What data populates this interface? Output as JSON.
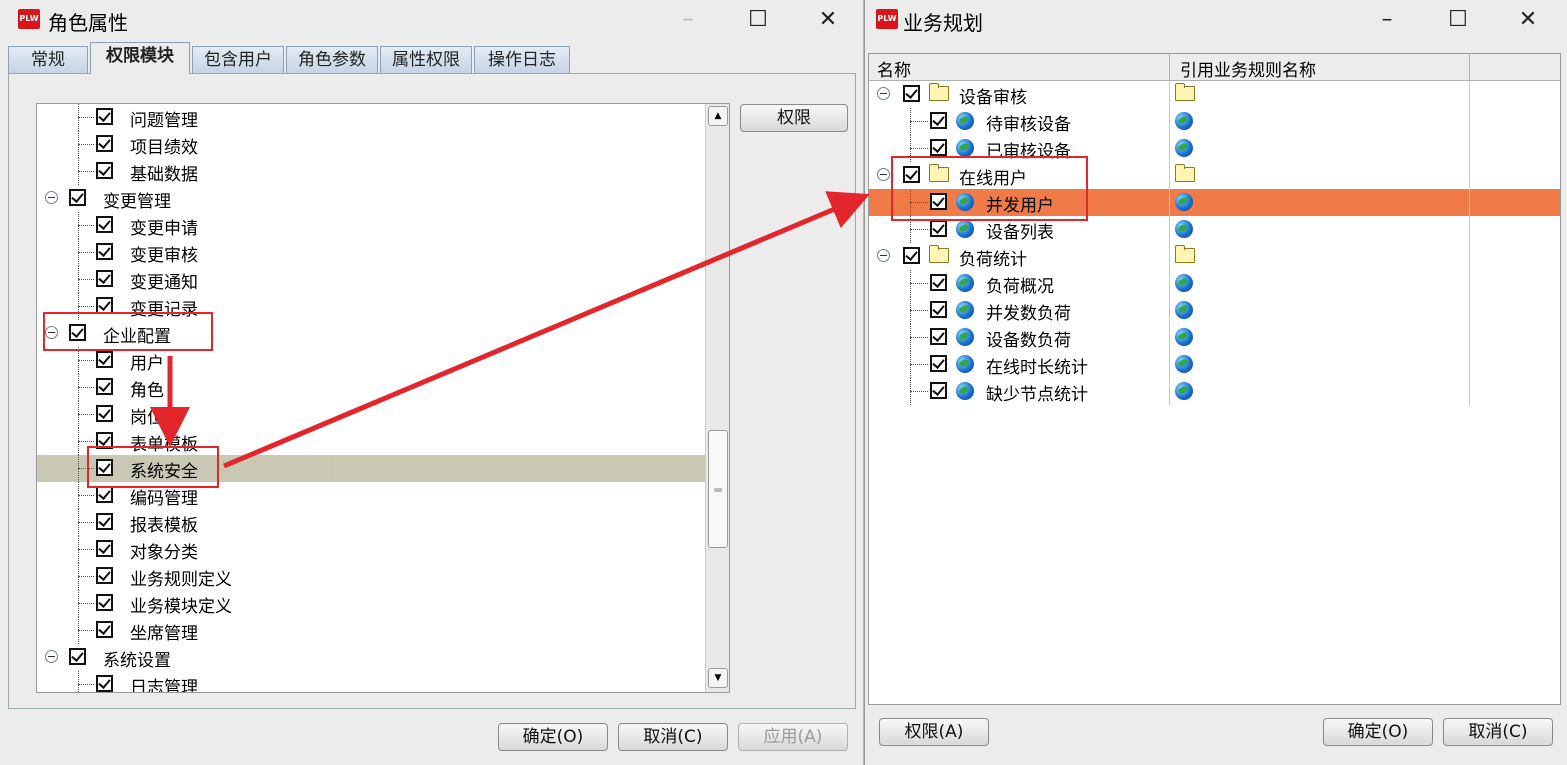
{
  "left_window": {
    "title": "角色属性",
    "logo": "PLW",
    "tabs": [
      "常规",
      "权限模块",
      "包含用户",
      "角色参数",
      "属性权限",
      "操作日志"
    ],
    "tree": [
      {
        "label": "问题管理",
        "level": 1
      },
      {
        "label": "项目绩效",
        "level": 1
      },
      {
        "label": "基础数据",
        "level": 1
      },
      {
        "label": "变更管理",
        "level": 0
      },
      {
        "label": "变更申请",
        "level": 1
      },
      {
        "label": "变更审核",
        "level": 1
      },
      {
        "label": "变更通知",
        "level": 1
      },
      {
        "label": "变更记录",
        "level": 1
      },
      {
        "label": "企业配置",
        "level": 0
      },
      {
        "label": "用户",
        "level": 1
      },
      {
        "label": "角色",
        "level": 1
      },
      {
        "label": "岗位",
        "level": 1
      },
      {
        "label": "表单模板",
        "level": 1
      },
      {
        "label": "系统安全",
        "level": 1,
        "selected": true
      },
      {
        "label": "编码管理",
        "level": 1
      },
      {
        "label": "报表模板",
        "level": 1
      },
      {
        "label": "对象分类",
        "level": 1
      },
      {
        "label": "业务规则定义",
        "level": 1
      },
      {
        "label": "业务模块定义",
        "level": 1
      },
      {
        "label": "坐席管理",
        "level": 1
      },
      {
        "label": "系统设置",
        "level": 0
      },
      {
        "label": "日志管理",
        "level": 1
      }
    ],
    "permission_button": "权限",
    "ok_button": "确定(O)",
    "cancel_button": "取消(C)",
    "apply_button": "应用(A)"
  },
  "right_window": {
    "title": "业务规划",
    "logo": "PLW",
    "columns": [
      "名称",
      "引用业务规则名称"
    ],
    "tree": [
      {
        "label": "设备审核",
        "level": 0,
        "icon": "folder"
      },
      {
        "label": "待审核设备",
        "level": 1,
        "icon": "globe"
      },
      {
        "label": "已审核设备",
        "level": 1,
        "icon": "globe"
      },
      {
        "label": "在线用户",
        "level": 0,
        "icon": "folder"
      },
      {
        "label": "并发用户",
        "level": 1,
        "icon": "globe",
        "highlighted": true
      },
      {
        "label": "设备列表",
        "level": 1,
        "icon": "globe"
      },
      {
        "label": "负荷统计",
        "level": 0,
        "icon": "folder"
      },
      {
        "label": "负荷概况",
        "level": 1,
        "icon": "globe"
      },
      {
        "label": "并发数负荷",
        "level": 1,
        "icon": "globe"
      },
      {
        "label": "设备数负荷",
        "level": 1,
        "icon": "globe"
      },
      {
        "label": "在线时长统计",
        "level": 1,
        "icon": "globe"
      },
      {
        "label": "缺少节点统计",
        "level": 1,
        "icon": "globe"
      }
    ],
    "permission_button": "权限(A)",
    "ok_button": "确定(O)",
    "cancel_button": "取消(C)"
  },
  "colors": {
    "selected_row": "#c8c8b4",
    "highlighted_row": "#f07a48",
    "annotation_red": "#e3262b"
  }
}
